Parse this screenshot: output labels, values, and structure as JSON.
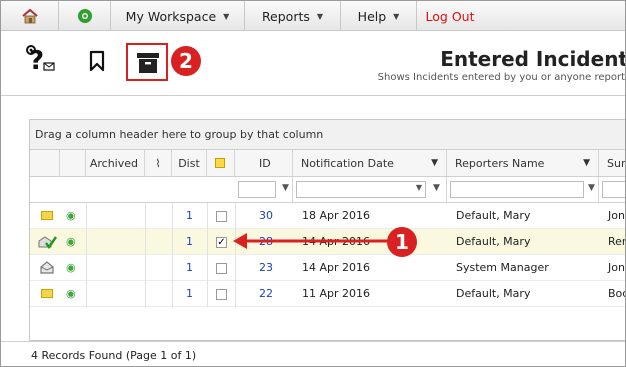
{
  "menu": {
    "workspace": "My Workspace",
    "reports": "Reports",
    "help": "Help",
    "logout": "Log Out"
  },
  "page": {
    "title": "Entered Incident",
    "subtitle": "Shows Incidents entered by you or anyone report"
  },
  "grid": {
    "group_hint": "Drag a column header here to group by that column",
    "columns": {
      "archived": "Archived",
      "dist": "Dist",
      "id": "ID",
      "notification_date": "Notification Date",
      "reporters_name": "Reporters Name",
      "surname": "Sur"
    },
    "rows": [
      {
        "dist": "1",
        "id": "30",
        "date": "18 Apr 2016",
        "reporter": "Default, Mary",
        "sur": "Jon",
        "checked": false,
        "status_icon": "envelope-icon"
      },
      {
        "dist": "1",
        "id": "28",
        "date": "14 Apr 2016",
        "reporter": "Default, Mary",
        "sur": "Rer",
        "checked": true,
        "status_icon": "envelope-open-check-icon"
      },
      {
        "dist": "1",
        "id": "23",
        "date": "14 Apr 2016",
        "reporter": "System Manager",
        "sur": "Jon",
        "checked": false,
        "status_icon": "envelope-open-icon"
      },
      {
        "dist": "1",
        "id": "22",
        "date": "11 Apr 2016",
        "reporter": "Default, Mary",
        "sur": "Boc",
        "checked": false,
        "status_icon": "envelope-icon"
      }
    ],
    "footer": "4 Records Found (Page 1 of 1)"
  },
  "callouts": {
    "one": "1",
    "two": "2"
  },
  "colors": {
    "accent_red": "#d92121",
    "link_blue": "#1a3fc0",
    "logout_red": "#dd1111"
  }
}
